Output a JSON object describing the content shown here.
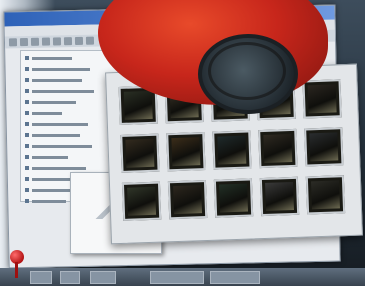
{
  "window": {
    "title": "",
    "menu": []
  },
  "outline": {
    "items_count_visible": 14
  },
  "gallery": {
    "thumbnails": [
      {
        "name": "thumb-1",
        "tone": "#2a2f24"
      },
      {
        "name": "thumb-2",
        "tone": "#3a3326"
      },
      {
        "name": "thumb-3",
        "tone": "#1e2220"
      },
      {
        "name": "thumb-4",
        "tone": "#26301f"
      },
      {
        "name": "thumb-5",
        "tone": "#2b2620"
      },
      {
        "name": "thumb-6",
        "tone": "#332b1f"
      },
      {
        "name": "thumb-7",
        "tone": "#3b2d1a"
      },
      {
        "name": "thumb-8",
        "tone": "#1f2a2b"
      },
      {
        "name": "thumb-9",
        "tone": "#2f2a22"
      },
      {
        "name": "thumb-10",
        "tone": "#2a2d2f"
      },
      {
        "name": "thumb-11",
        "tone": "#303629"
      },
      {
        "name": "thumb-12",
        "tone": "#2d271e"
      },
      {
        "name": "thumb-13",
        "tone": "#223026"
      },
      {
        "name": "thumb-14",
        "tone": "#3a3a3a"
      },
      {
        "name": "thumb-15",
        "tone": "#2c2c26"
      }
    ]
  },
  "colors": {
    "accent_red": "#c7261b",
    "titlebar_blue": "#2e62b8",
    "taskbar": "#38434f"
  }
}
